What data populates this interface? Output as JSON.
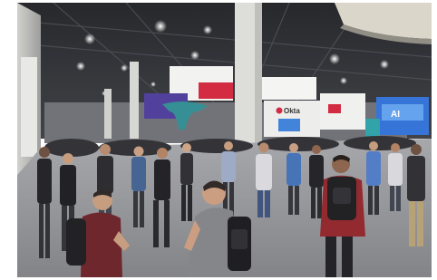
{
  "photo": {
    "description_label": "",
    "signs": {
      "booth_brand": "Okta",
      "booth_right": "",
      "blue_screen": "AI"
    },
    "colors": {
      "ceiling": "#2b2d31",
      "floor": "#8d8e92",
      "pillar": "#dcdcd8",
      "booth_red": "#d2233a",
      "booth_blue": "#2f6fd6",
      "booth_purple": "#4a3a9a",
      "teal_structure": "#2e8b91"
    }
  }
}
